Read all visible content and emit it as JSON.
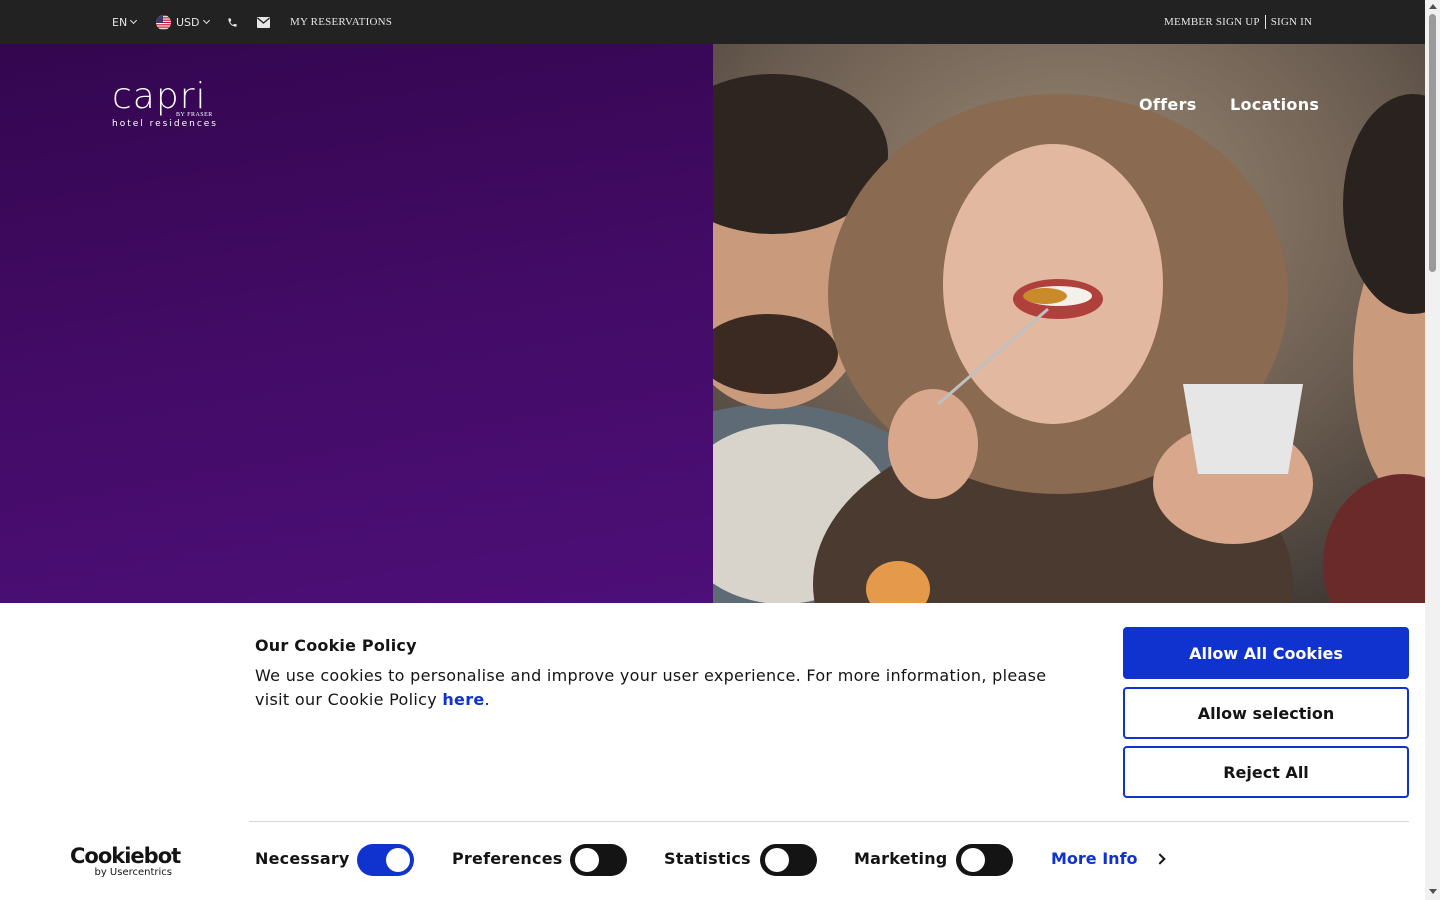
{
  "topbar": {
    "language": "EN",
    "currency": "USD",
    "my_reservations": "MY RESERVATIONS",
    "member_sign_up": "MEMBER SIGN UP",
    "sign_in": "SIGN IN"
  },
  "logo": {
    "main": "capri",
    "by": "BY FRASER",
    "sub": "hotel residences"
  },
  "nav": {
    "offers": "Offers",
    "locations": "Locations"
  },
  "cookie": {
    "title": "Our Cookie Policy",
    "text": "We use cookies to personalise and improve your user experience. For more information, please visit our Cookie Policy ",
    "link": "here",
    "period": ".",
    "allow_all": "Allow All Cookies",
    "allow_selection": "Allow selection",
    "reject_all": "Reject All",
    "brand_main": "Cookiebot",
    "brand_sub": "by Usercentrics",
    "toggles": [
      {
        "label": "Necessary",
        "on": true
      },
      {
        "label": "Preferences",
        "on": false
      },
      {
        "label": "Statistics",
        "on": false
      },
      {
        "label": "Marketing",
        "on": false
      }
    ],
    "more_info": "More Info"
  },
  "colors": {
    "accent": "#1032cf",
    "topbar": "#222222",
    "hero_purple": "#430b66"
  }
}
